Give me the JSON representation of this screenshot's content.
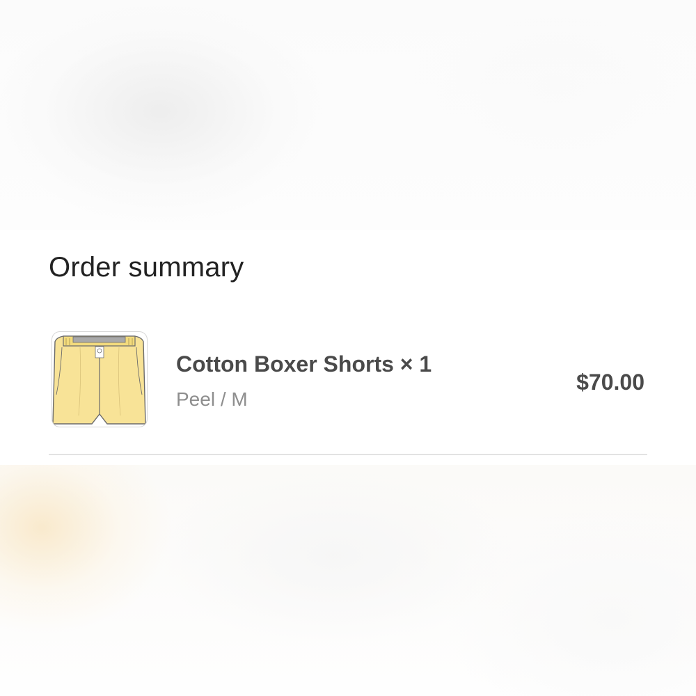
{
  "order_summary": {
    "heading": "Order summary",
    "line_items": [
      {
        "title": "Cotton Boxer Shorts × 1",
        "variant": "Peel / M",
        "price": "$70.00",
        "thumbnail_icon": "boxer-shorts-image",
        "thumbnail_color": "#f8e397"
      }
    ]
  },
  "colors": {
    "heading_text": "#222222",
    "item_text": "#4a4a4a",
    "variant_text": "#8e8e8e",
    "divider": "#e3e3e3"
  }
}
